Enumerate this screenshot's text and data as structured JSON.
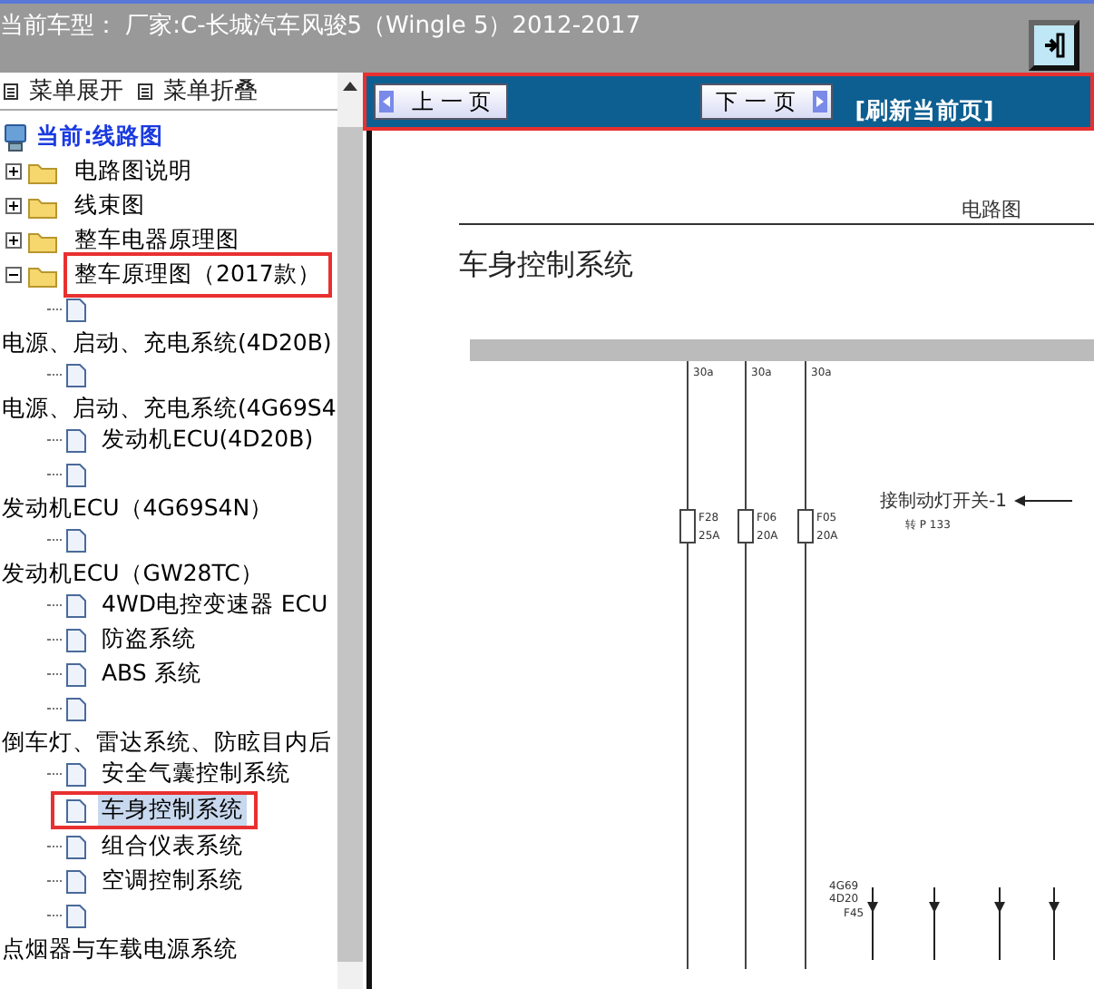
{
  "header": {
    "title": "当前车型：  厂家:C-长城汽车风骏5（Wingle 5）2012-2017"
  },
  "menu": [
    {
      "label": "菜单展开"
    },
    {
      "label": "菜单折叠"
    }
  ],
  "tree": {
    "root": {
      "label": "当前:线路图"
    },
    "items": [
      {
        "kind": "folder",
        "label": "电路图说明",
        "expanded": false,
        "highlighted": false
      },
      {
        "kind": "folder",
        "label": "线束图",
        "expanded": false,
        "highlighted": false
      },
      {
        "kind": "folder",
        "label": "整车电器原理图",
        "expanded": false,
        "highlighted": false
      },
      {
        "kind": "folder",
        "label": "整车原理图（2017款）",
        "expanded": true,
        "highlighted": true,
        "children": [
          {
            "kind": "leaf",
            "selected": false,
            "highlighted": false
          },
          {
            "kind": "caption",
            "label": "电源、启动、充电系统(4D20B)"
          },
          {
            "kind": "leaf",
            "selected": false,
            "highlighted": false
          },
          {
            "kind": "caption",
            "label": "电源、启动、充电系统(4G69S4"
          },
          {
            "kind": "leaf",
            "label": "发动机ECU(4D20B)",
            "selected": false,
            "highlighted": false
          },
          {
            "kind": "leaf",
            "selected": false,
            "highlighted": false
          },
          {
            "kind": "caption",
            "label": "发动机ECU（4G69S4N）"
          },
          {
            "kind": "leaf",
            "selected": false,
            "highlighted": false
          },
          {
            "kind": "caption",
            "label": "发动机ECU（GW28TC）"
          },
          {
            "kind": "leaf",
            "label": "4WD电控变速器 ECU",
            "selected": false,
            "highlighted": false
          },
          {
            "kind": "leaf",
            "label": "防盗系统",
            "selected": false,
            "highlighted": false
          },
          {
            "kind": "leaf",
            "label": "ABS 系统",
            "selected": false,
            "highlighted": false
          },
          {
            "kind": "leaf",
            "selected": false,
            "highlighted": false
          },
          {
            "kind": "caption",
            "label": "倒车灯、雷达系统、防眩目内后"
          },
          {
            "kind": "leaf",
            "label": "安全气囊控制系统",
            "selected": false,
            "highlighted": false
          },
          {
            "kind": "leaf",
            "label": "车身控制系统",
            "selected": true,
            "highlighted": true
          },
          {
            "kind": "leaf",
            "label": "组合仪表系统",
            "selected": false,
            "highlighted": false
          },
          {
            "kind": "leaf",
            "label": "空调控制系统",
            "selected": false,
            "highlighted": false
          },
          {
            "kind": "leaf",
            "selected": false,
            "highlighted": false
          },
          {
            "kind": "caption",
            "label": "点烟器与车载电源系统"
          }
        ]
      }
    ]
  },
  "nav": {
    "highlighted": true,
    "prev": "上 一 页",
    "next": "下 一 页",
    "refresh": "[刷新当前页]"
  },
  "document": {
    "section": "电路图",
    "title": "车身控制系统",
    "supplies": [
      "30a",
      "30a",
      "30a"
    ],
    "fuses": [
      {
        "name": "F28",
        "rating": "25A"
      },
      {
        "name": "F06",
        "rating": "20A"
      },
      {
        "name": "F05",
        "rating": "20A"
      }
    ],
    "side_label": {
      "line1": "接制动灯开关-1",
      "line2": "转 P 133"
    },
    "bottom_labels": [
      "4G69",
      "4D20",
      "F45"
    ]
  }
}
